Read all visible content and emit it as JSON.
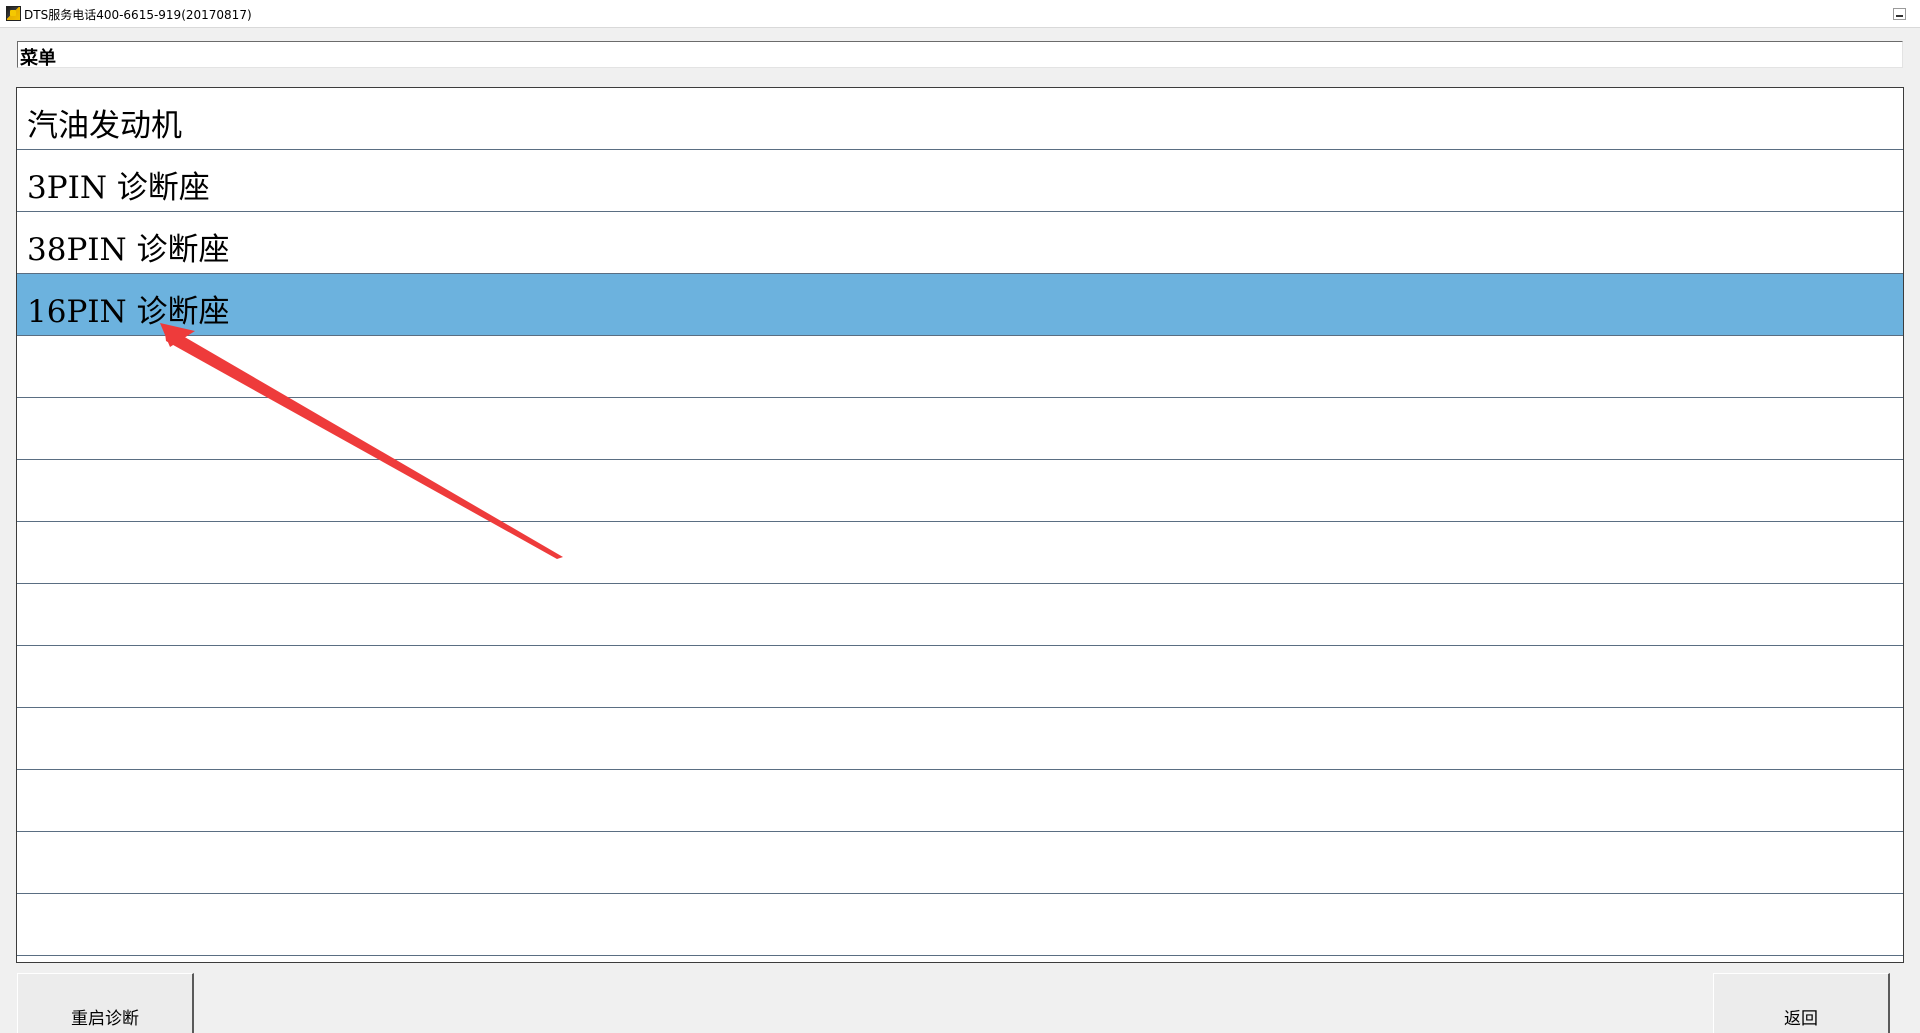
{
  "window": {
    "title": "DTS服务电话400-6615-919(20170817)",
    "icon": "app-logo-icon"
  },
  "menu_header": {
    "label": "菜单"
  },
  "menu": {
    "items": [
      {
        "label": "汽油发动机",
        "selected": false
      },
      {
        "label": "3PIN 诊断座",
        "selected": false
      },
      {
        "label": "38PIN 诊断座",
        "selected": false
      },
      {
        "label": "16PIN 诊断座",
        "selected": true
      },
      {
        "label": "",
        "selected": false
      },
      {
        "label": "",
        "selected": false
      },
      {
        "label": "",
        "selected": false
      },
      {
        "label": "",
        "selected": false
      },
      {
        "label": "",
        "selected": false
      },
      {
        "label": "",
        "selected": false
      },
      {
        "label": "",
        "selected": false
      },
      {
        "label": "",
        "selected": false
      },
      {
        "label": "",
        "selected": false
      },
      {
        "label": "",
        "selected": false
      }
    ]
  },
  "buttons": {
    "restart_label": "重启诊断",
    "back_label": "返回"
  },
  "colors": {
    "selected_row": "#6cb2de",
    "row_divider": "#5a6e82",
    "annotation_arrow": "#ee3b3b"
  }
}
